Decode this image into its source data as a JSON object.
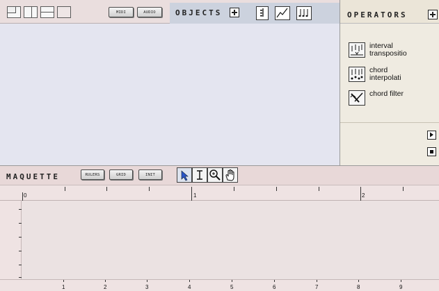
{
  "top": {
    "midi_label": "MIDI",
    "audio_label": "AUDIO",
    "objects_label": "OBJECTS"
  },
  "operators": {
    "title": "OPERATORS",
    "items": [
      {
        "line1": "interval",
        "line2": "transpositio",
        "icon": "interval-transposition-icon"
      },
      {
        "line1": "chord",
        "line2": "interpolati",
        "icon": "chord-interpolation-icon"
      },
      {
        "line1": "chord filter",
        "line2": "",
        "icon": "chord-filter-icon"
      }
    ]
  },
  "maquette": {
    "title": "MAQUETTE",
    "rulers_label": "RULERS",
    "grid_label": "GRID",
    "init_label": "INIT",
    "top_ruler_labels": [
      "0",
      "1",
      "2"
    ],
    "bottom_ruler_labels": [
      "1",
      "2",
      "3",
      "4",
      "5",
      "6",
      "7",
      "8",
      "9"
    ]
  }
}
